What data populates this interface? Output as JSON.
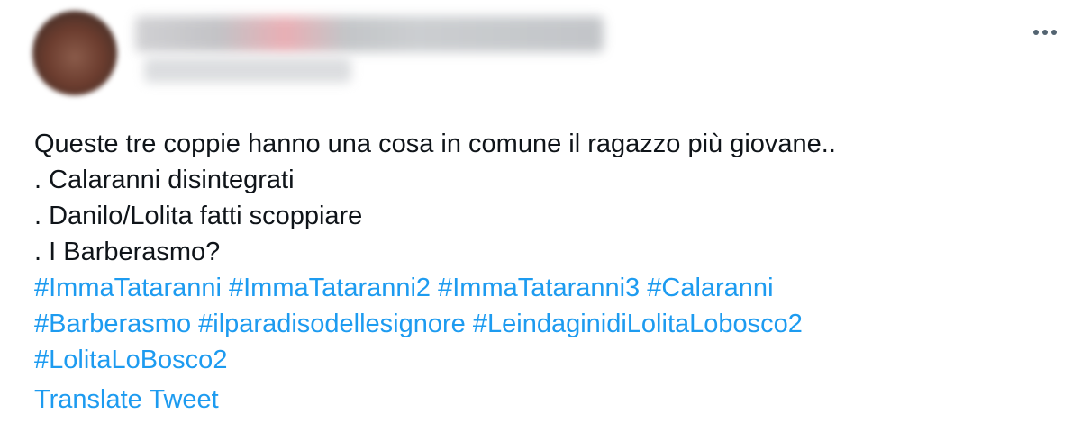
{
  "tweet": {
    "more_icon": "more-horizontal-icon",
    "text_lines": [
      "Queste tre coppie hanno una cosa in comune il ragazzo più giovane..",
      ". Calaranni disintegrati",
      ". Danilo/Lolita fatti scoppiare",
      ". I Barberasmo?"
    ],
    "hashtags": [
      "#ImmaTataranni",
      "#ImmaTataranni2",
      "#ImmaTataranni3",
      "#Calaranni",
      "#Barberasmo",
      "#ilparadisodellesignore",
      "#LeindaginidiLolitaLobosco2",
      "#LolitaLoBosco2"
    ],
    "translate_label": "Translate Tweet"
  },
  "colors": {
    "text": "#0f1419",
    "link": "#1d9bf0",
    "secondary": "#536471"
  }
}
